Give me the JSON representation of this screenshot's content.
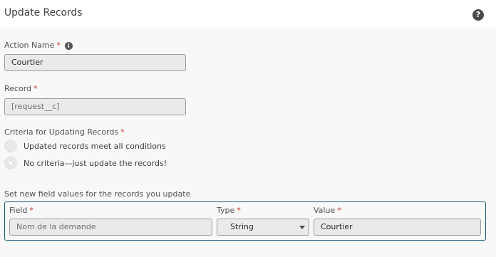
{
  "header": {
    "title": "Update Records",
    "help_icon": "question-mark-icon",
    "help_glyph": "?"
  },
  "action_name": {
    "label": "Action Name",
    "required": "*",
    "info_icon": "info-icon",
    "info_glyph": "i",
    "value": "Courtier"
  },
  "record": {
    "label": "Record",
    "required": "*",
    "value": "[request__c]"
  },
  "criteria": {
    "label": "Criteria for Updating Records",
    "required": "*",
    "options": [
      {
        "label": "Updated records meet all conditions",
        "checked": false
      },
      {
        "label": "No criteria—just update the records!",
        "checked": true
      }
    ]
  },
  "field_values": {
    "section_label": "Set new field values for the records you update",
    "field_label": "Field",
    "type_label": "Type",
    "value_label": "Value",
    "required": "*",
    "field_placeholder": "Nom de la demande",
    "type_value": "String",
    "value": "Courtier"
  },
  "colors": {
    "required": "#c23934",
    "row_border": "#1b5c7a",
    "input_bg": "#e9eaeb"
  }
}
